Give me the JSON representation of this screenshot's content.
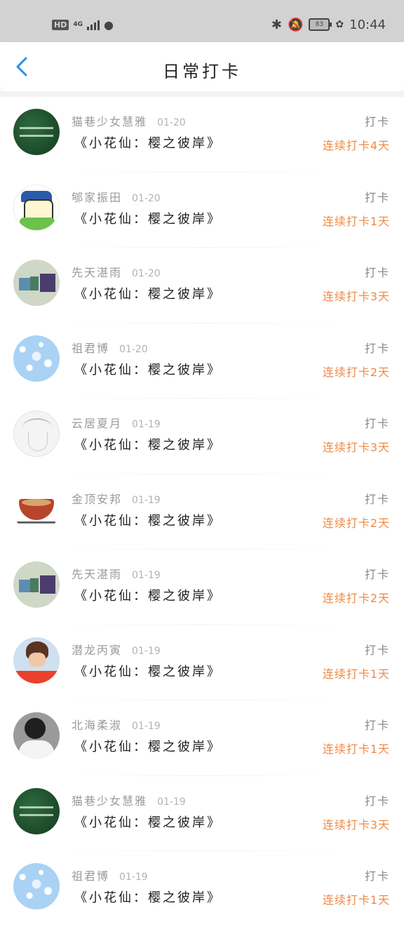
{
  "status_bar": {
    "hd": "HD",
    "network": "4G",
    "battery": "83",
    "time": "10:44"
  },
  "header": {
    "title": "日常打卡",
    "back_icon": "chevron-left-icon"
  },
  "colors": {
    "accent": "#2a8be8",
    "streak": "#f08a46"
  },
  "checkins": [
    {
      "user": "猫巷少女慧雅",
      "date": "01-20",
      "book": "《小花仙：樱之彼岸》",
      "action": "打卡",
      "streak": "连续打卡4天"
    },
    {
      "user": "郇家振田",
      "date": "01-20",
      "book": "《小花仙：樱之彼岸》",
      "action": "打卡",
      "streak": "连续打卡1天"
    },
    {
      "user": "先天湛雨",
      "date": "01-20",
      "book": "《小花仙：樱之彼岸》",
      "action": "打卡",
      "streak": "连续打卡3天"
    },
    {
      "user": "祖君博",
      "date": "01-20",
      "book": "《小花仙：樱之彼岸》",
      "action": "打卡",
      "streak": "连续打卡2天"
    },
    {
      "user": "云居夏月",
      "date": "01-19",
      "book": "《小花仙：樱之彼岸》",
      "action": "打卡",
      "streak": "连续打卡3天"
    },
    {
      "user": "金顶安邦",
      "date": "01-19",
      "book": "《小花仙：樱之彼岸》",
      "action": "打卡",
      "streak": "连续打卡2天"
    },
    {
      "user": "先天湛雨",
      "date": "01-19",
      "book": "《小花仙：樱之彼岸》",
      "action": "打卡",
      "streak": "连续打卡2天"
    },
    {
      "user": "潜龙丙寅",
      "date": "01-19",
      "book": "《小花仙：樱之彼岸》",
      "action": "打卡",
      "streak": "连续打卡1天"
    },
    {
      "user": "北海柔淑",
      "date": "01-19",
      "book": "《小花仙：樱之彼岸》",
      "action": "打卡",
      "streak": "连续打卡1天"
    },
    {
      "user": "猫巷少女慧雅",
      "date": "01-19",
      "book": "《小花仙：樱之彼岸》",
      "action": "打卡",
      "streak": "连续打卡3天"
    },
    {
      "user": "祖君博",
      "date": "01-19",
      "book": "《小花仙：樱之彼岸》",
      "action": "打卡",
      "streak": "连续打卡1天"
    }
  ]
}
